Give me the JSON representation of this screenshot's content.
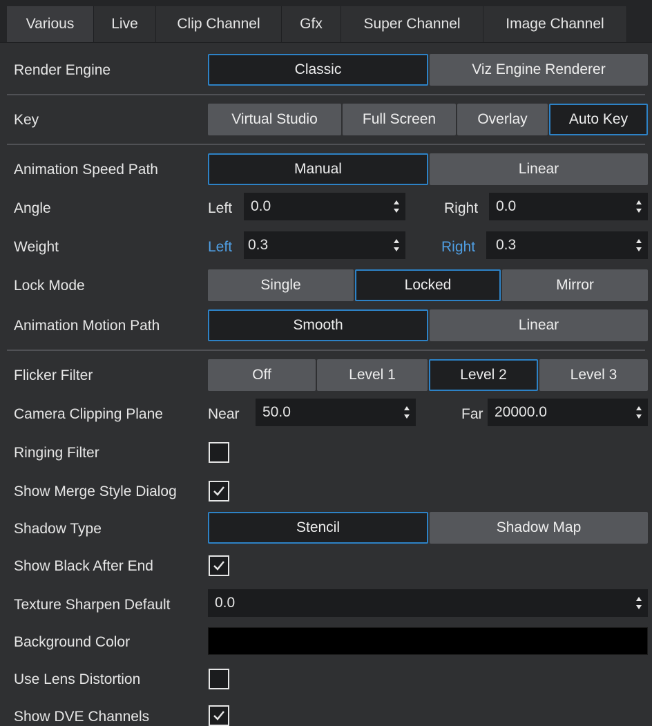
{
  "tabs": [
    {
      "label": "Various",
      "active": true
    },
    {
      "label": "Live",
      "active": false
    },
    {
      "label": "Clip Channel",
      "active": false
    },
    {
      "label": "Gfx",
      "active": false
    },
    {
      "label": "Super Channel",
      "active": false
    },
    {
      "label": "Image Channel",
      "active": false
    }
  ],
  "render_engine": {
    "label": "Render Engine",
    "options": [
      "Classic",
      "Viz Engine Renderer"
    ],
    "selected": "Classic"
  },
  "key": {
    "label": "Key",
    "options": [
      "Virtual Studio",
      "Full Screen",
      "Overlay",
      "Auto Key"
    ],
    "selected": "Auto Key"
  },
  "anim_speed_path": {
    "label": "Animation Speed Path",
    "options": [
      "Manual",
      "Linear"
    ],
    "selected": "Manual"
  },
  "angle": {
    "label": "Angle",
    "left_label": "Left",
    "left_value": "0.0",
    "right_label": "Right",
    "right_value": "0.0"
  },
  "weight": {
    "label": "Weight",
    "left_label": "Left",
    "left_value": "0.3",
    "right_label": "Right",
    "right_value": "0.3",
    "link_color": "#4f9fe4"
  },
  "lock_mode": {
    "label": "Lock Mode",
    "options": [
      "Single",
      "Locked",
      "Mirror"
    ],
    "selected": "Locked"
  },
  "anim_motion_path": {
    "label": "Animation Motion Path",
    "options": [
      "Smooth",
      "Linear"
    ],
    "selected": "Smooth"
  },
  "flicker_filter": {
    "label": "Flicker Filter",
    "options": [
      "Off",
      "Level 1",
      "Level 2",
      "Level 3"
    ],
    "selected": "Level 2"
  },
  "camera_clipping": {
    "label": "Camera Clipping Plane",
    "near_label": "Near",
    "near_value": "50.0",
    "far_label": "Far",
    "far_value": "20000.0"
  },
  "ringing_filter": {
    "label": "Ringing Filter",
    "checked": false
  },
  "show_merge_style": {
    "label": "Show Merge Style Dialog",
    "checked": true
  },
  "shadow_type": {
    "label": "Shadow Type",
    "options": [
      "Stencil",
      "Shadow Map"
    ],
    "selected": "Stencil"
  },
  "show_black_after_end": {
    "label": "Show Black After End",
    "checked": true
  },
  "texture_sharpen": {
    "label": "Texture Sharpen Default",
    "value": "0.0"
  },
  "background_color": {
    "label": "Background Color",
    "color": "#000000"
  },
  "use_lens_distortion": {
    "label": "Use Lens Distortion",
    "checked": false
  },
  "show_dve_channels": {
    "label": "Show DVE Channels",
    "checked": true
  },
  "colors": {
    "accent": "#2d82c6",
    "panel": "#2f3032",
    "button": "#55575b",
    "field": "#1b1c1e"
  }
}
